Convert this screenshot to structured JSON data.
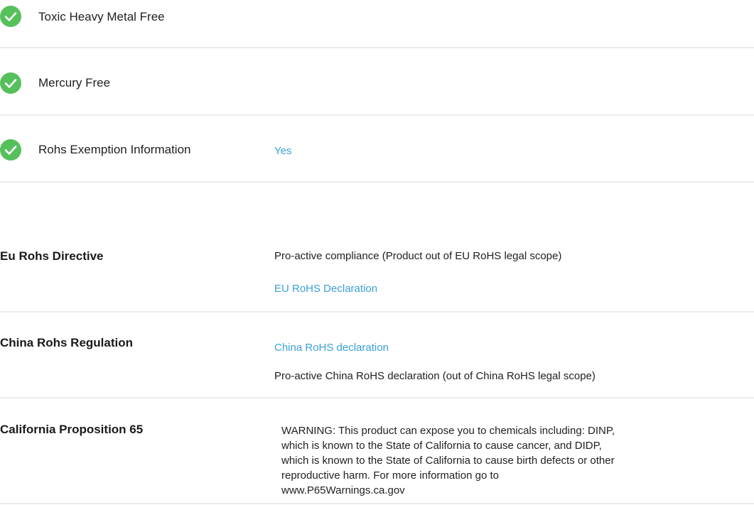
{
  "colors": {
    "check": "#56c05b",
    "link": "#3aa0d8",
    "divider": "#ececec"
  },
  "environmental_checks": [
    {
      "icon": "check-circle-icon",
      "label": "Toxic Heavy Metal Free"
    },
    {
      "icon": "check-circle-icon",
      "label": "Mercury Free"
    },
    {
      "icon": "check-circle-icon",
      "label": "Rohs Exemption Information",
      "value": "Yes"
    }
  ],
  "regulations": {
    "eu_rohs": {
      "title": "Eu Rohs Directive",
      "status": "Pro-active compliance (Product out of EU RoHS legal scope)",
      "link": "EU RoHS Declaration"
    },
    "china_rohs": {
      "title": "China Rohs Regulation",
      "link": "China RoHS declaration",
      "status": "Pro-active China RoHS declaration (out of China RoHS legal scope)"
    },
    "california_prop65": {
      "title": "California Proposition 65",
      "warning": "WARNING: This product can expose you to chemicals including: DINP, which is known to the State of California to cause cancer, and DIDP, which is known to the State of California to cause birth defects or other reproductive harm. For more information go to www.P65Warnings.ca.gov"
    }
  }
}
